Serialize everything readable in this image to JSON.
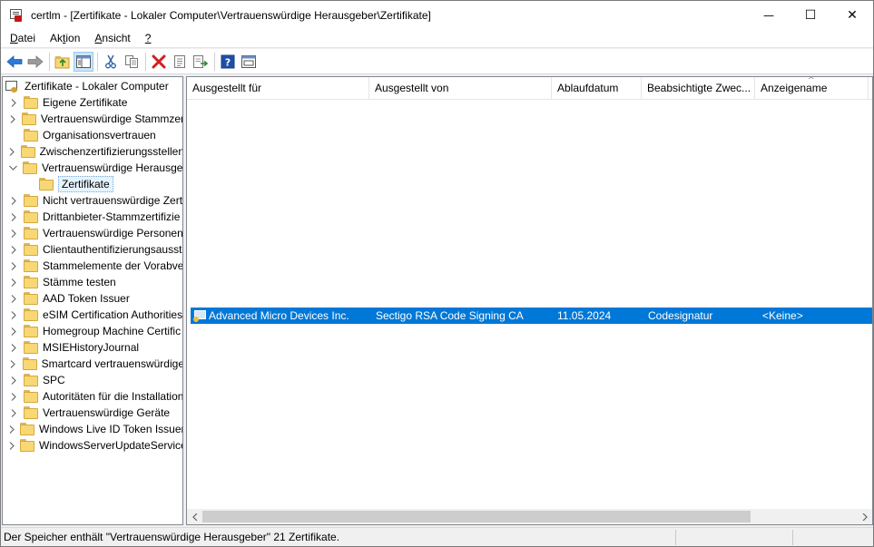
{
  "window": {
    "title": "certlm - [Zertifikate - Lokaler Computer\\Vertrauenswürdige Herausgeber\\Zertifikate]",
    "minimize_glyph": "—",
    "maximize_glyph": "☐",
    "close_glyph": "✕"
  },
  "menu": {
    "items": [
      {
        "label": "Datei",
        "ul": "D",
        "rest": "atei"
      },
      {
        "label": "Aktion",
        "pre": "Ak",
        "ul": "t",
        "rest": "ion"
      },
      {
        "label": "Ansicht",
        "ul": "A",
        "rest": "nsicht"
      },
      {
        "label": "?",
        "ul": "?",
        "rest": ""
      }
    ]
  },
  "toolbar": {
    "buttons": [
      "back-icon",
      "forward-icon",
      "up-folder-icon",
      "show-hide-tree-icon",
      "cut-icon",
      "copy-icon",
      "delete-icon",
      "properties-icon",
      "export-list-icon",
      "help-icon",
      "view-icon"
    ]
  },
  "tree": {
    "root": "Zertifikate - Lokaler Computer",
    "items": [
      {
        "label": "Eigene Zertifikate",
        "chevron": "right"
      },
      {
        "label": "Vertrauenswürdige Stammzer",
        "chevron": "right"
      },
      {
        "label": "Organisationsvertrauen",
        "chevron": "none"
      },
      {
        "label": "Zwischenzertifizierungsstellen",
        "chevron": "right"
      },
      {
        "label": "Vertrauenswürdige Herausgeber",
        "chevron": "down"
      },
      {
        "label": "Zertifikate",
        "chevron": "none",
        "child": true,
        "selected": true
      },
      {
        "label": "Nicht vertrauenswürdige Zert",
        "chevron": "right"
      },
      {
        "label": "Drittanbieter-Stammzertifizie",
        "chevron": "right"
      },
      {
        "label": "Vertrauenswürdige Personen",
        "chevron": "right"
      },
      {
        "label": "Clientauthentifizierungsausst",
        "chevron": "right"
      },
      {
        "label": "Stammelemente der Vorabve",
        "chevron": "right"
      },
      {
        "label": "Stämme testen",
        "chevron": "right"
      },
      {
        "label": "AAD Token Issuer",
        "chevron": "right"
      },
      {
        "label": "eSIM Certification Authorities",
        "chevron": "right"
      },
      {
        "label": "Homegroup Machine Certific",
        "chevron": "right"
      },
      {
        "label": "MSIEHistoryJournal",
        "chevron": "right"
      },
      {
        "label": "Smartcard vertrauenswürdige",
        "chevron": "right"
      },
      {
        "label": "SPC",
        "chevron": "right"
      },
      {
        "label": "Autoritäten für die Installation",
        "chevron": "right"
      },
      {
        "label": "Vertrauenswürdige Geräte",
        "chevron": "right"
      },
      {
        "label": "Windows Live ID Token Issuer",
        "chevron": "right"
      },
      {
        "label": "WindowsServerUpdateServices",
        "chevron": "right"
      }
    ]
  },
  "list": {
    "columns": [
      "Ausgestellt für",
      "Ausgestellt von",
      "Ablaufdatum",
      "Beabsichtigte Zwec...",
      "Anzeigename"
    ],
    "sort_glyph": "^",
    "rows": [
      {
        "issued_to": "Advanced Micro Devices Inc.",
        "issued_by": "Sectigo RSA Code Signing CA",
        "expiry": "11.05.2024",
        "purpose": "Codesignatur",
        "friendly_name": "<Keine>"
      }
    ]
  },
  "status": {
    "text": "Der Speicher enthält \"Vertrauenswürdige Herausgeber\" 21 Zertifikate."
  },
  "colors": {
    "selection": "#0078d7",
    "folder": "#f8d775",
    "delete": "#d21f1f",
    "help": "#1f4fa8"
  }
}
